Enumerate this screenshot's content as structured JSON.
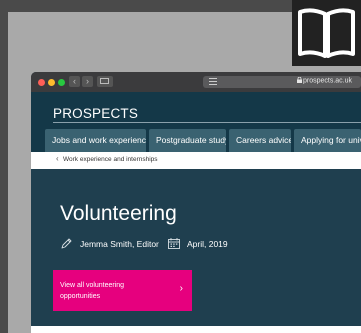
{
  "browser": {
    "url": "prospects.ac.uk",
    "back_glyph": "‹",
    "forward_glyph": "›"
  },
  "site": {
    "logo": "PROSPECTS",
    "nav_tabs": [
      {
        "label": "Jobs and work experience"
      },
      {
        "label": "Postgraduate study"
      },
      {
        "label": "Careers advice"
      },
      {
        "label": "Applying for univer"
      }
    ],
    "breadcrumb": {
      "chevron": "‹",
      "label": "Work experience and internships"
    }
  },
  "article": {
    "title": "Volunteering",
    "author": "Jemma Smith, Editor",
    "date": "April, 2019"
  },
  "cta": {
    "label": "View all volunteering opportunities",
    "arrow": "›"
  },
  "colors": {
    "header_bg": "#143848",
    "tab_bg": "#3a6271",
    "hero_bg": "#1f3f4f",
    "cta_bg": "#e6007e"
  }
}
